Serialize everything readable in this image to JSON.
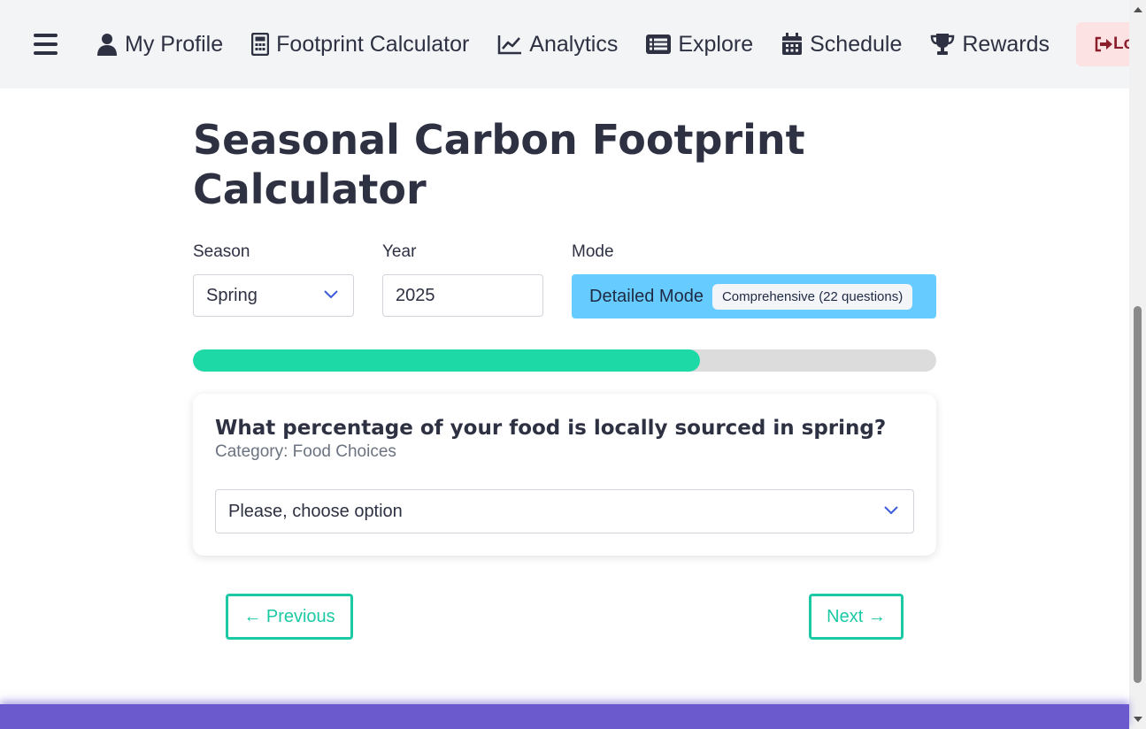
{
  "nav": {
    "menu_icon": "hamburger-icon",
    "items": [
      {
        "label": "My Profile",
        "icon": "user-icon"
      },
      {
        "label": "Footprint Calculator",
        "icon": "calculator-icon"
      },
      {
        "label": "Analytics",
        "icon": "chart-line-icon"
      },
      {
        "label": "Explore",
        "icon": "list-icon"
      },
      {
        "label": "Schedule",
        "icon": "calendar-icon"
      },
      {
        "label": "Rewards",
        "icon": "trophy-icon"
      }
    ],
    "logout_label": "Lo",
    "logout_icon": "sign-out-icon"
  },
  "page": {
    "title": "Seasonal Carbon Footprint Calculator"
  },
  "controls": {
    "season_label": "Season",
    "season_value": "Spring",
    "year_label": "Year",
    "year_value": "2025",
    "mode_label": "Mode",
    "mode_value": "Detailed Mode",
    "mode_tag": "Comprehensive (22 questions)"
  },
  "progress": {
    "fraction": 0.682
  },
  "question_card": {
    "question": "What percentage of your food is locally sourced in spring?",
    "category": "Category: Food Choices",
    "answer_placeholder": "Please, choose option"
  },
  "buttons": {
    "previous": "← Previous",
    "next": "Next →"
  },
  "colors": {
    "accent": "#1cc9a5",
    "mode_bg": "#66ccff",
    "footer": "#6a5acd",
    "logout_bg": "#fde2e4"
  }
}
